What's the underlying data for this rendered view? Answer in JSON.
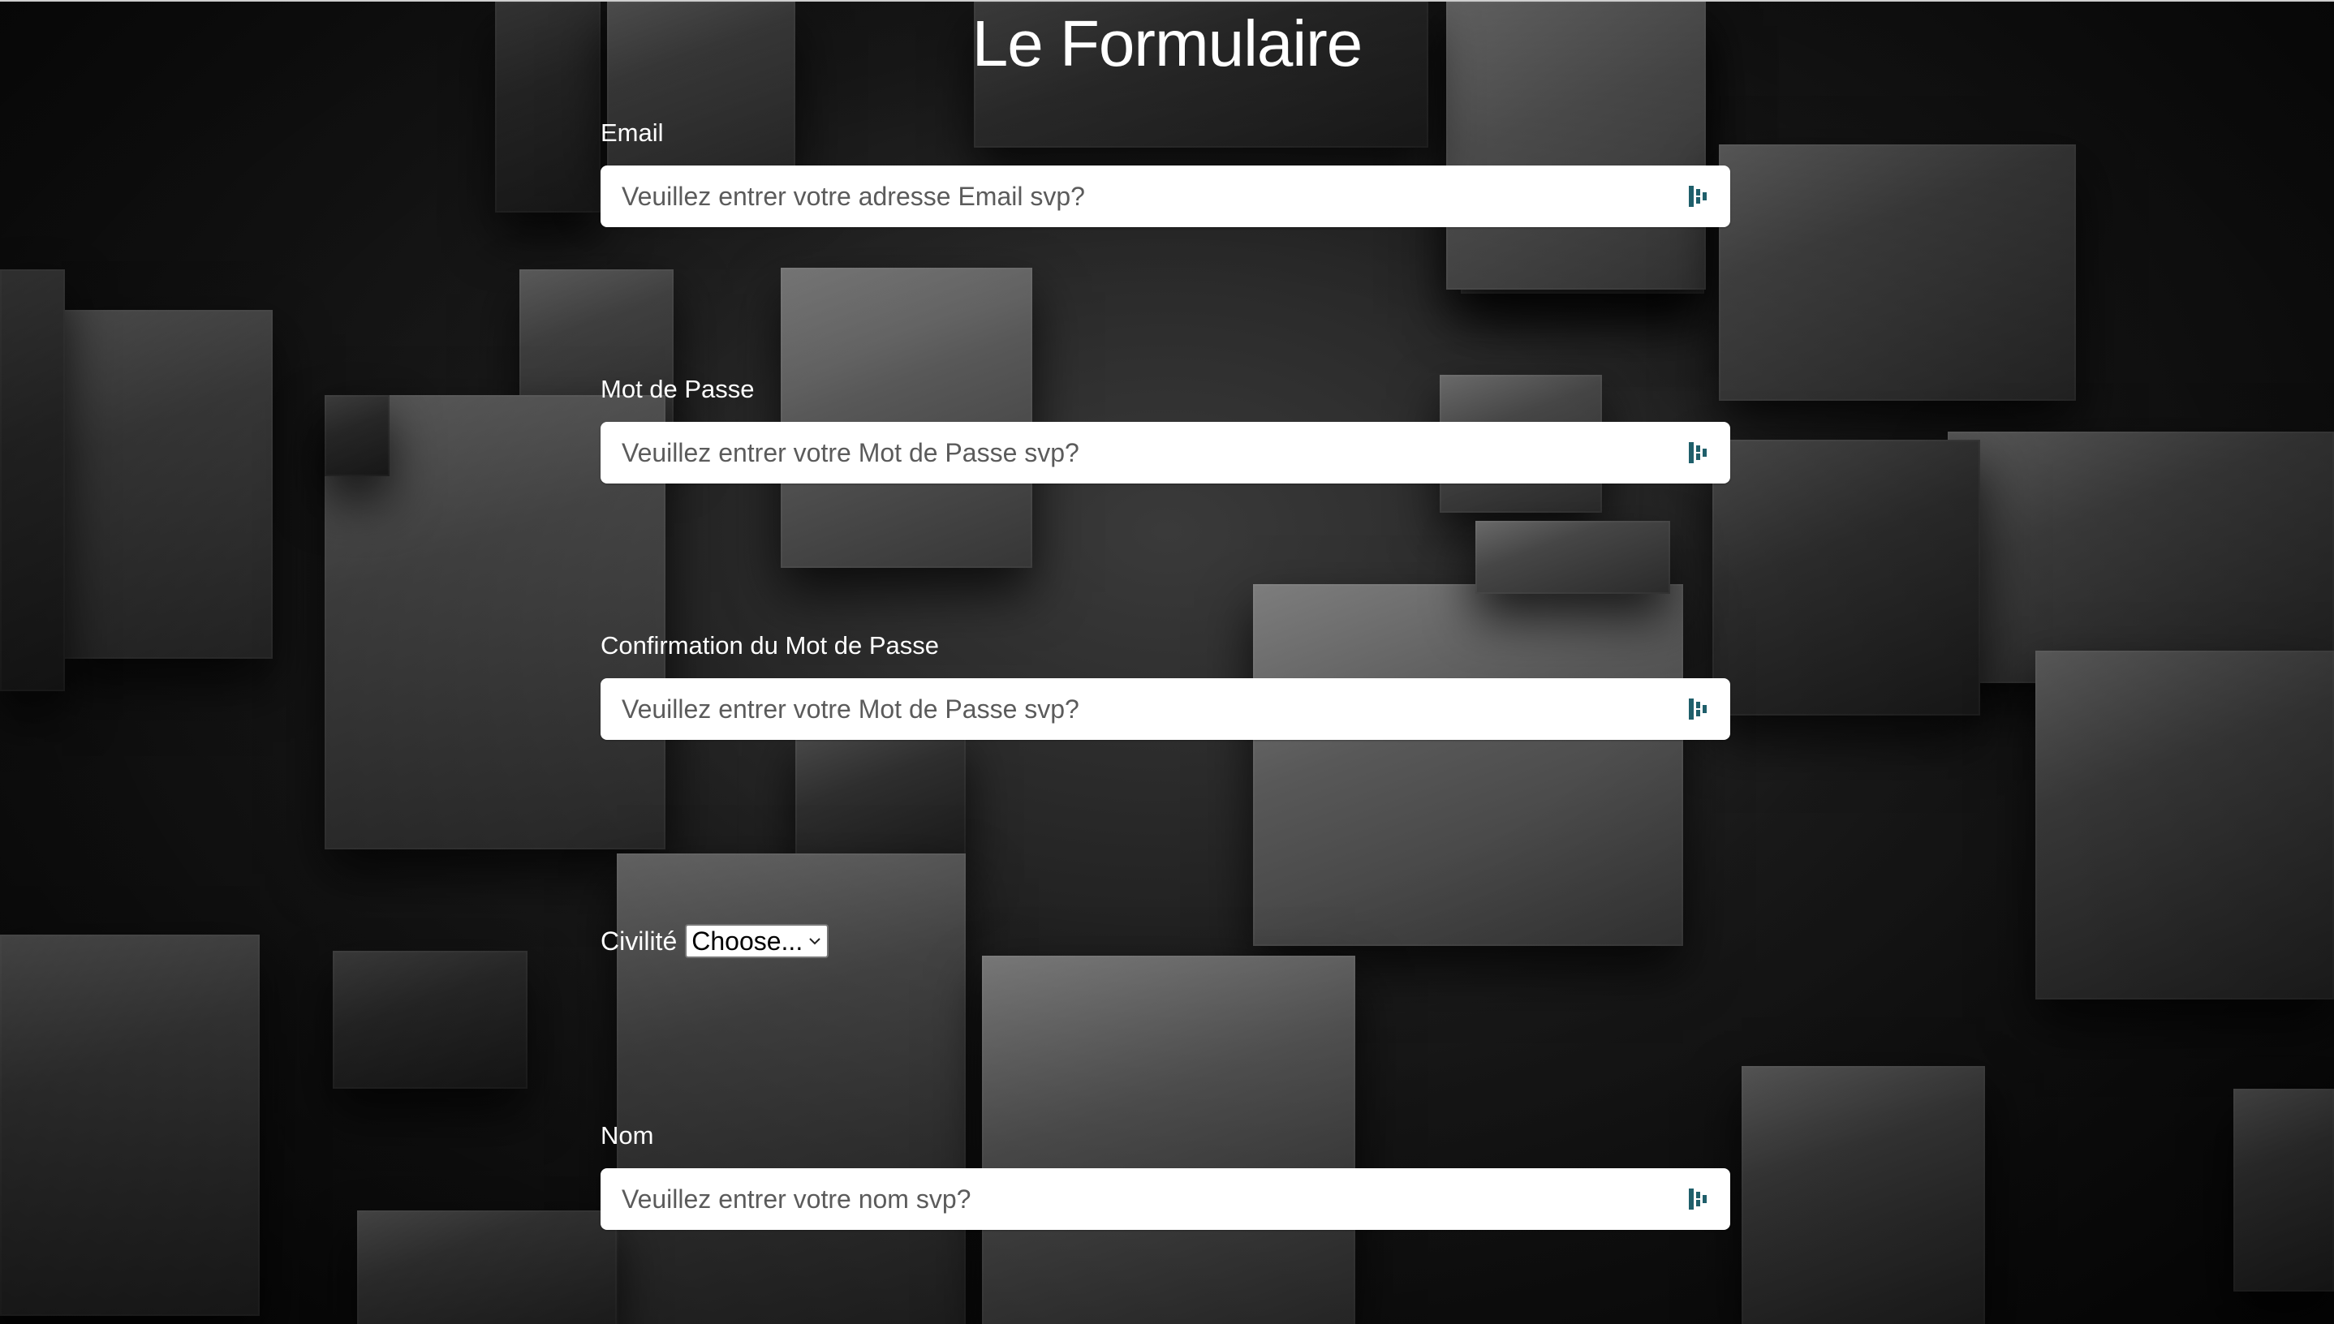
{
  "title": "Le Formulaire",
  "fields": {
    "email": {
      "label": "Email",
      "placeholder": "Veuillez entrer votre adresse Email svp?"
    },
    "password": {
      "label": "Mot de Passe",
      "placeholder": "Veuillez entrer votre Mot de Passe svp?"
    },
    "password_confirm": {
      "label": "Confirmation du Mot de Passe",
      "placeholder": "Veuillez entrer votre Mot de Passe svp?"
    },
    "civility": {
      "label": "Civilité",
      "selected": "Choose..."
    },
    "name": {
      "label": "Nom",
      "placeholder": "Veuillez entrer votre nom svp?"
    }
  },
  "icons": {
    "field_icon": "password-manager-icon",
    "select_icon": "chevron-down-icon"
  },
  "colors": {
    "background": "#111111",
    "text": "#ffffff",
    "input_bg": "#ffffff",
    "icon_accent": "#1f5f6b"
  }
}
